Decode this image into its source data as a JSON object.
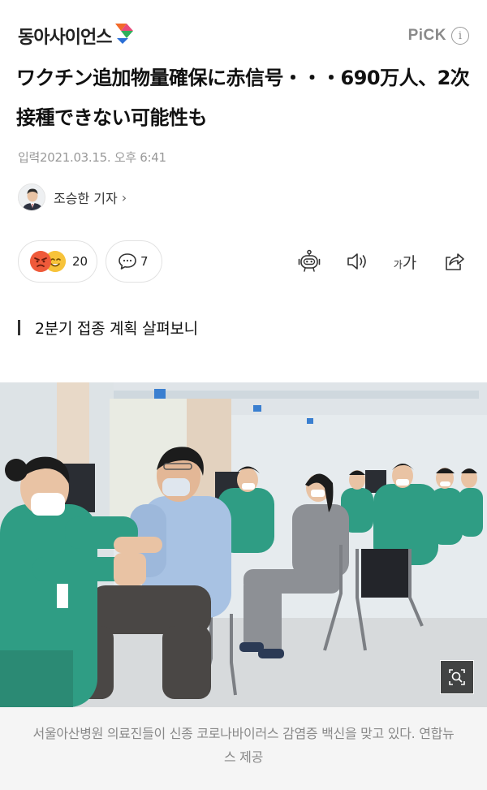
{
  "header": {
    "logo_text": "동아사이언스",
    "pick_label": "PiCK",
    "info_symbol": "i"
  },
  "article": {
    "title": "ワクチン追加物量確保に赤信号・・・690万人、2次接種できない可能性も",
    "date": "입력2021.03.15. 오후 6:41",
    "reporter": "조승한 기자",
    "reporter_chevron": "›",
    "subheading": "2분기 접종 계획 살펴보니"
  },
  "actions": {
    "reaction_count": "20",
    "comment_count": "7",
    "font_size_small": "가",
    "font_size_large": "가"
  },
  "icons": {
    "reaction_angry": "angry-emoji-icon",
    "reaction_smile": "smile-emoji-icon",
    "comment": "speech-bubble-icon",
    "summary_bot": "robot-icon",
    "audio": "speaker-icon",
    "font": "font-size-icon",
    "share": "share-icon",
    "zoom": "magnify-icon"
  },
  "photo": {
    "caption": "서울아산병원 의료진들이 신종 코로나바이러스 감염증 백신을 맞고 있다. 연합뉴스 제공"
  },
  "colors": {
    "logo_green": "#2fae5b",
    "logo_orange": "#f26a2a",
    "logo_blue": "#2b6fd6",
    "reaction_angry": "#ef5a3a",
    "reaction_smile": "#f7c33a",
    "scrub_green": "#2f9d84",
    "caption_bg": "#f5f5f5"
  }
}
